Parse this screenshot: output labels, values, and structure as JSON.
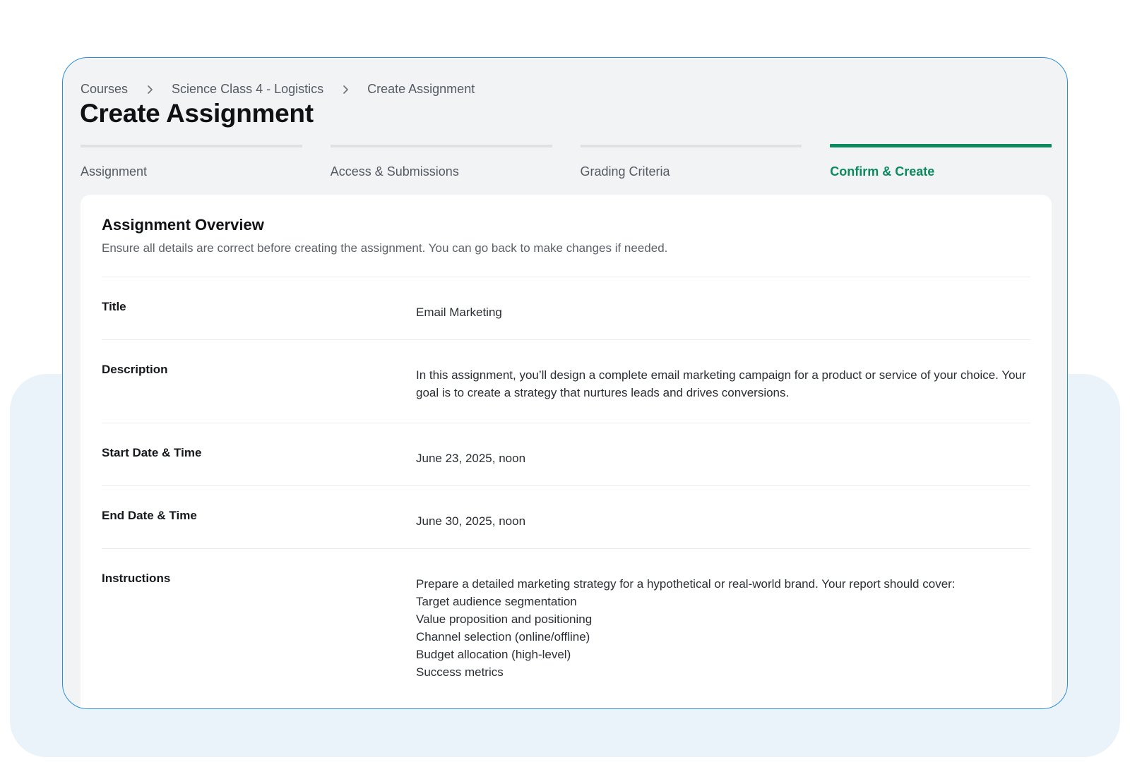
{
  "breadcrumb": {
    "items": [
      "Courses",
      "Science Class 4 - Logistics",
      "Create Assignment"
    ]
  },
  "page_title": "Create Assignment",
  "steps": [
    {
      "label": "Assignment",
      "active": false
    },
    {
      "label": "Access & Submissions",
      "active": false
    },
    {
      "label": "Grading Criteria",
      "active": false
    },
    {
      "label": "Confirm & Create",
      "active": true
    }
  ],
  "overview": {
    "title": "Assignment Overview",
    "subtitle": "Ensure all details are correct before creating the assignment. You can go back to make changes if needed.",
    "fields": {
      "title": {
        "label": "Title",
        "value": "Email Marketing"
      },
      "description": {
        "label": "Description",
        "value": "In this assignment, you’ll design a complete email marketing campaign for a product or service of your choice. Your goal is to create a strategy that nurtures leads and drives conversions."
      },
      "start": {
        "label": "Start Date & Time",
        "value": "June 23, 2025, noon"
      },
      "end": {
        "label": "End Date & Time",
        "value": "June 30, 2025, noon"
      },
      "instructions": {
        "label": "Instructions",
        "lines": [
          "Prepare a detailed marketing strategy for a hypothetical or real-world brand. Your report should cover:",
          "Target audience segmentation",
          "Value proposition and positioning",
          "Channel selection (online/offline)",
          "Budget allocation (high-level)",
          "Success metrics"
        ]
      }
    }
  },
  "colors": {
    "accent": "#0a8a5d",
    "frame_border": "#2d8fd3",
    "background_panel": "#eaf3fa"
  },
  "icons": {
    "breadcrumb_separator": "chevron-right-icon"
  }
}
